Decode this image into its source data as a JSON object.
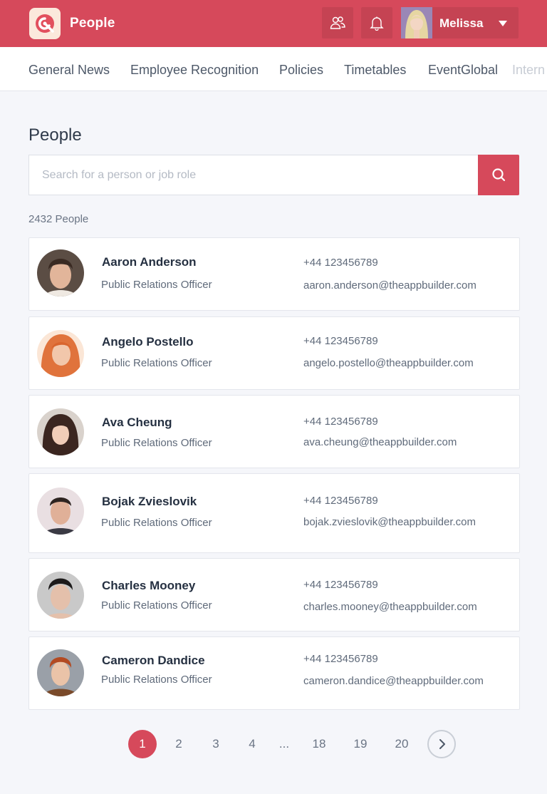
{
  "header": {
    "app_title": "People",
    "user_name": "Melissa",
    "icons": [
      "app-logo-icon",
      "people-icon",
      "bell-icon",
      "dropdown-caret-icon"
    ],
    "brand_color": "#d6495b"
  },
  "tabs": [
    "General News",
    "Employee Recognition",
    "Policies",
    "Timetables",
    "EventGlobal",
    "Intern"
  ],
  "main": {
    "title": "People",
    "search_placeholder": "Search for a person or job role",
    "search_value": "",
    "count_label": "2432 People"
  },
  "people": [
    {
      "name": "Aaron Anderson",
      "role": "Public Relations Officer",
      "phone": "+44 123456789",
      "email": "aaron.anderson@theappbuilder.com"
    },
    {
      "name": "Angelo Postello",
      "role": "Public Relations Officer",
      "phone": "+44 123456789",
      "email": "angelo.postello@theappbuilder.com"
    },
    {
      "name": "Ava Cheung",
      "role": "Public Relations Officer",
      "phone": "+44 123456789",
      "email": "ava.cheung@theappbuilder.com"
    },
    {
      "name": "Bojak Zvieslovik",
      "role": "Public Relations Officer",
      "phone": "+44 123456789",
      "email": "bojak.zvieslovik@theappbuilder.com"
    },
    {
      "name": "Charles Mooney",
      "role": "Public Relations Officer",
      "phone": "+44 123456789",
      "email": "charles.mooney@theappbuilder.com"
    },
    {
      "name": "Cameron Dandice",
      "role": "Public Relations Officer",
      "phone": "+44 123456789",
      "email": "cameron.dandice@theappbuilder.com"
    }
  ],
  "pagination": {
    "pages": [
      "1",
      "2",
      "3",
      "4",
      "...",
      "18",
      "19",
      "20"
    ],
    "current": "1",
    "next_icon": "chevron-right-icon"
  }
}
